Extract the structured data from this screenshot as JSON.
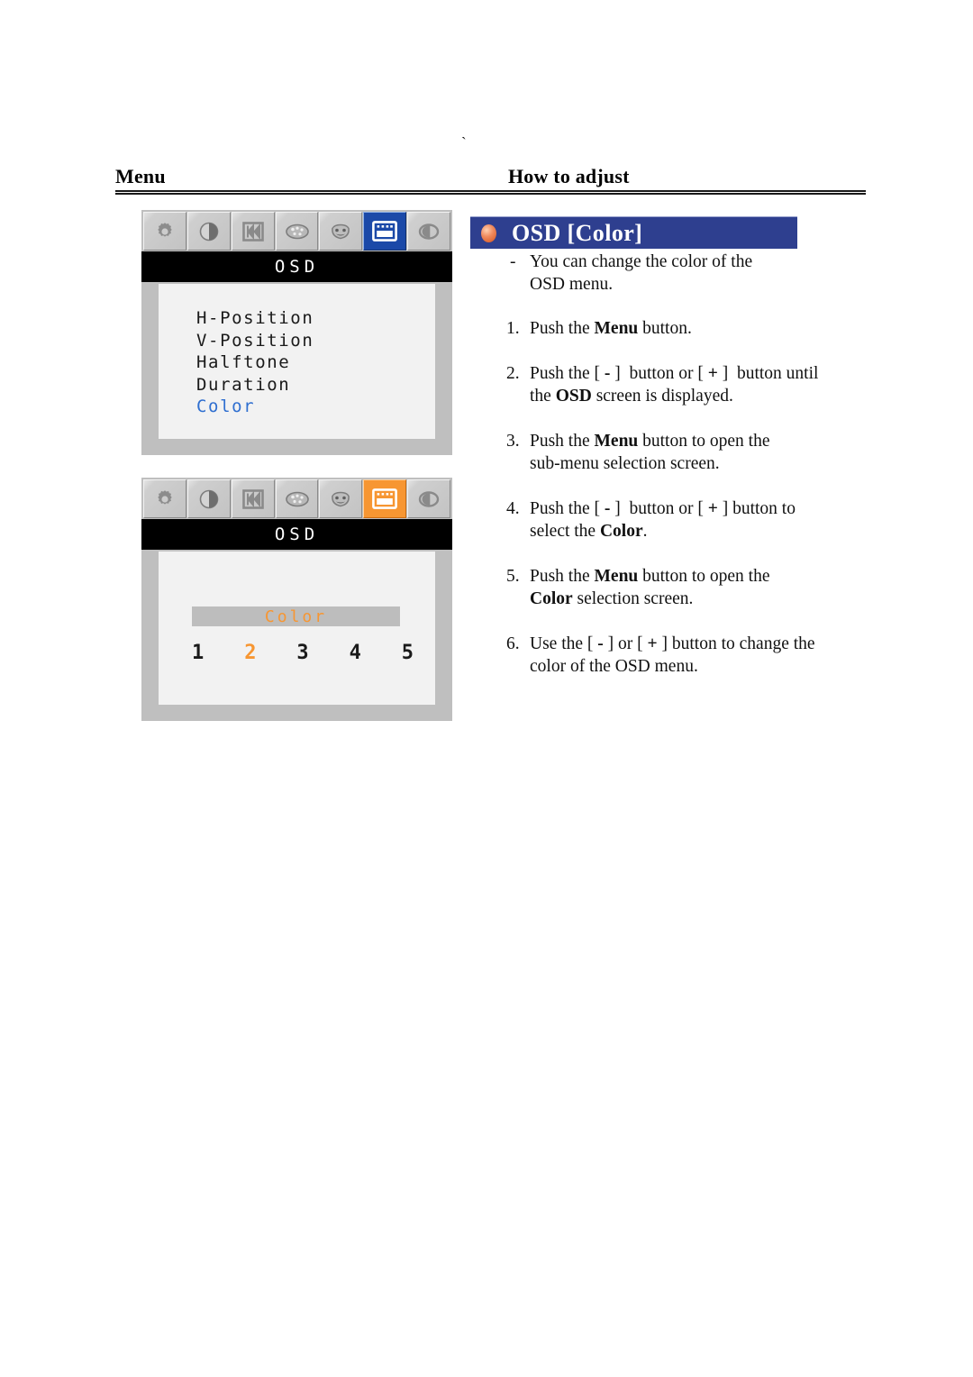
{
  "page": {
    "tick_mark": "`",
    "background": "#ffffff"
  },
  "header": {
    "left_title": "Menu",
    "right_title": "How to adjust"
  },
  "colors": {
    "title_bar_blue": "#2e3f8f",
    "osd_select_blue": "#1b49a8",
    "osd_select_orange": "#f79632",
    "osd_panel_gray": "#bfbfbf",
    "osd_screen_white": "#f2f2f2",
    "osd_header_black": "#000000",
    "highlight_blue_text": "#2f6fd0",
    "highlight_orange_text": "#f79632"
  },
  "osd_panels": [
    {
      "name": "osd-menu-list",
      "title": "OSD",
      "toolbar": [
        {
          "icon": "gear-icon",
          "label": "Picture",
          "selected": false
        },
        {
          "icon": "contrast-icon",
          "label": "Contrast",
          "selected": false
        },
        {
          "icon": "position-icon",
          "label": "Position",
          "selected": false
        },
        {
          "icon": "palette-icon",
          "label": "Color",
          "selected": false
        },
        {
          "icon": "face-icon",
          "label": "Language",
          "selected": false
        },
        {
          "icon": "osd-window-icon",
          "label": "OSD",
          "selected": true
        },
        {
          "icon": "power-icon",
          "label": "Reset",
          "selected": false
        }
      ],
      "selection_color": "#1b49a8",
      "items": [
        {
          "label": "H-Position",
          "highlighted": false
        },
        {
          "label": "V-Position",
          "highlighted": false
        },
        {
          "label": "Halftone",
          "highlighted": false
        },
        {
          "label": "Duration",
          "highlighted": false
        },
        {
          "label": "Color",
          "highlighted": true
        }
      ]
    },
    {
      "name": "osd-color-selection",
      "title": "OSD",
      "toolbar": [
        {
          "icon": "gear-icon",
          "label": "Picture",
          "selected": false
        },
        {
          "icon": "contrast-icon",
          "label": "Contrast",
          "selected": false
        },
        {
          "icon": "position-icon",
          "label": "Position",
          "selected": false
        },
        {
          "icon": "palette-icon",
          "label": "Color",
          "selected": false
        },
        {
          "icon": "face-icon",
          "label": "Language",
          "selected": false
        },
        {
          "icon": "osd-window-icon",
          "label": "OSD",
          "selected": true
        },
        {
          "icon": "power-icon",
          "label": "Reset",
          "selected": false
        }
      ],
      "selection_color": "#f79632",
      "bar_label": "Color",
      "options": [
        {
          "value": "1",
          "active": false
        },
        {
          "value": "2",
          "active": true
        },
        {
          "value": "3",
          "active": false
        },
        {
          "value": "4",
          "active": false
        },
        {
          "value": "5",
          "active": false
        }
      ]
    }
  ],
  "instructions": {
    "title": "OSD [Color]",
    "bullet_icon": "orange-sphere-icon",
    "dash_marker": "-",
    "description": "You can change the color of the OSD menu.",
    "steps": [
      {
        "number": "1.",
        "text": "Push the Menu button."
      },
      {
        "number": "2.",
        "text": "Push the [ - ]  button or [ + ]  button until the OSD screen is displayed."
      },
      {
        "number": "3.",
        "text": "Push the Menu button to open the sub-menu selection screen."
      },
      {
        "number": "4.",
        "text": "Push the [ - ]  button or [ + ] button to select the Color."
      },
      {
        "number": "5.",
        "text": "Push the Menu button to open the Color selection screen."
      },
      {
        "number": "6.",
        "text": "Use the [ - ] or [ + ] button to change the color of the OSD menu."
      }
    ]
  }
}
